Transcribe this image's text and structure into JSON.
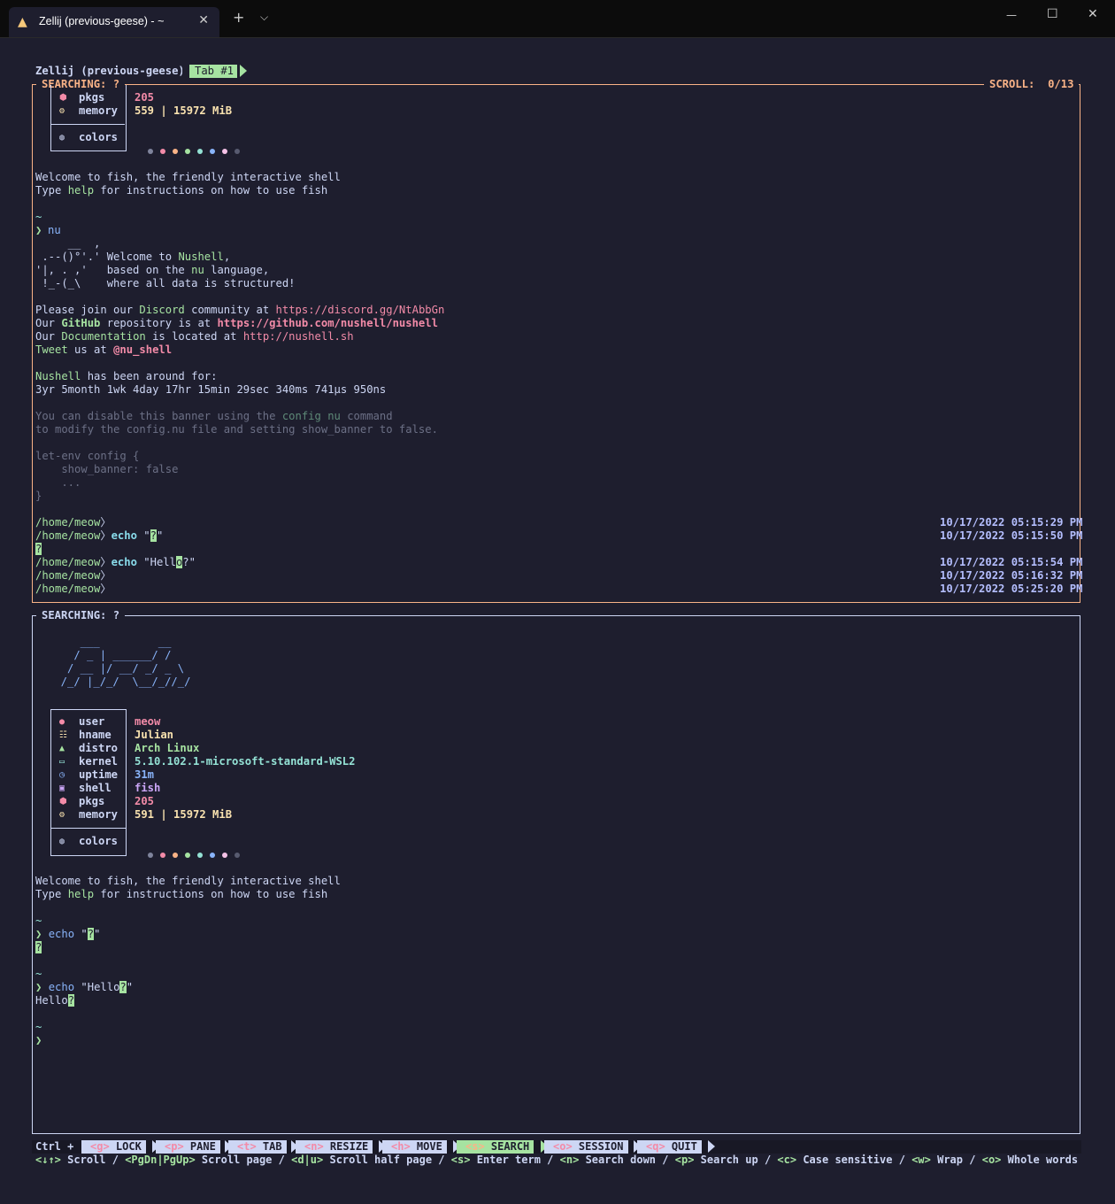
{
  "window": {
    "tab_title": "Zellij (previous-geese) - ~",
    "new_tab": "+",
    "dropdown": "⌵",
    "minimize": "—",
    "maximize": "☐",
    "close": "✕",
    "tab_close": "✕"
  },
  "zellij": {
    "session_label": "Zellij (previous-geese)",
    "tab_label": "Tab #1"
  },
  "pane1": {
    "title": "SEARCHING: ?",
    "scroll_label": "SCROLL:",
    "scroll_value": "0/13",
    "sysinfo": [
      {
        "label": "pkgs",
        "value": "205"
      },
      {
        "label": "memory",
        "value": "559 | 15972 MiB"
      }
    ],
    "colors_label": "colors",
    "fish_welcome_1": "Welcome to fish, the friendly interactive shell",
    "fish_welcome_2_a": "Type ",
    "fish_welcome_2_b": "help",
    "fish_welcome_2_c": " for instructions on how to use fish",
    "tilde": "~",
    "prompt_char": "❯",
    "nu_cmd": "nu",
    "nu_art_1": "     __  ,",
    "nu_art_2": " .--()°'.' Welcome to ",
    "nu_art_2_b": "Nushell",
    "nu_art_2_c": ",",
    "nu_art_3": "'|, . ,'   based on the ",
    "nu_art_3_b": "nu",
    "nu_art_3_c": " language,",
    "nu_art_4": " !_-(_\\    where all data is structured!",
    "discord_a": "Please join our ",
    "discord_b": "Discord",
    "discord_c": " community at ",
    "discord_d": "https://discord.gg/NtAbbGn",
    "github_a": "Our ",
    "github_b": "GitHub",
    "github_c": " repository is at ",
    "github_d": "https://github.com/nushell/nushell",
    "docs_a": "Our ",
    "docs_b": "Documentation",
    "docs_c": " is located at ",
    "docs_d": "http://nushell.sh",
    "tweet_a": "Tweet",
    "tweet_b": " us at ",
    "tweet_c": "@nu_shell",
    "around_a": "Nushell",
    "around_b": " has been around for:",
    "uptime": "3yr 5month 1wk 4day 17hr 15min 29sec 340ms 741µs 950ns",
    "disable_1_a": "You can disable this banner using the ",
    "disable_1_b": "config nu",
    "disable_1_c": " command",
    "disable_2": "to modify the config.nu file and setting show_banner to false.",
    "letenv_1": "let-env config {",
    "letenv_2": "    show_banner: false",
    "letenv_3": "    ...",
    "letenv_4": "}",
    "path": "/home/meow",
    "echo_cmd": "echo",
    "echo_arg1_a": "\"",
    "echo_arg1_b": "?",
    "echo_arg1_c": "\"",
    "out_q": "?",
    "echo_arg2_a": "\"Hell",
    "echo_arg2_b": "o",
    "echo_arg2_c": "?\"",
    "timestamps": [
      "10/17/2022 05:15:29 PM",
      "10/17/2022 05:15:50 PM",
      "10/17/2022 05:15:54 PM",
      "10/17/2022 05:16:32 PM",
      "10/17/2022 05:25:20 PM"
    ]
  },
  "pane2": {
    "title": "SEARCHING: ?",
    "arch_art": [
      "    ___              __",
      "   /   |  _________/ /_",
      "  / /| | / ___/ ___/ __ \\",
      " / ___ |/ /  / /__/ / / /",
      "/_/  |_/_/   \\___/_/ /_/"
    ],
    "arch_art_real": [
      "     ___         __",
      "    / _ | ______/ /",
      "   / __ |/ __/ _/ _ \\",
      "  /_/ |_/_/  \\__/_//_/"
    ],
    "sysinfo": [
      {
        "label": "user",
        "value": "meow",
        "icon": "user-icon"
      },
      {
        "label": "hname",
        "value": "Julian",
        "icon": "hostname-icon"
      },
      {
        "label": "distro",
        "value": "Arch Linux",
        "icon": "distro-icon"
      },
      {
        "label": "kernel",
        "value": "5.10.102.1-microsoft-standard-WSL2",
        "icon": "kernel-icon"
      },
      {
        "label": "uptime",
        "value": "31m",
        "icon": "clock-icon"
      },
      {
        "label": "shell",
        "value": "fish",
        "icon": "shell-icon"
      },
      {
        "label": "pkgs",
        "value": "205",
        "icon": "package-icon"
      },
      {
        "label": "memory",
        "value": "591 | 15972 MiB",
        "icon": "memory-icon"
      }
    ],
    "colors_label": "colors",
    "fish_welcome_1": "Welcome to fish, the friendly interactive shell",
    "fish_welcome_2_a": "Type ",
    "fish_welcome_2_b": "help",
    "fish_welcome_2_c": " for instructions on how to use fish",
    "tilde": "~",
    "prompt_char": "❯",
    "echo_cmd": "echo",
    "echo1_a": "\"",
    "echo1_b": "?",
    "echo1_c": "\"",
    "out1": "?",
    "echo2_a": "\"Hello",
    "echo2_b": "?",
    "echo2_c": "\"",
    "out2_a": "Hello",
    "out2_b": "?"
  },
  "statusbar": {
    "ctrl_label": "Ctrl +",
    "modes": [
      {
        "key": "<g>",
        "label": "LOCK"
      },
      {
        "key": "<p>",
        "label": "PANE"
      },
      {
        "key": "<t>",
        "label": "TAB"
      },
      {
        "key": "<n>",
        "label": "RESIZE"
      },
      {
        "key": "<h>",
        "label": "MOVE"
      },
      {
        "key": "<s>",
        "label": "SEARCH"
      },
      {
        "key": "<o>",
        "label": "SESSION"
      },
      {
        "key": "<q>",
        "label": "QUIT"
      }
    ],
    "hints": [
      {
        "key": "<↓↑>",
        "label": "Scroll"
      },
      {
        "key": "<PgDn|PgUp>",
        "label": "Scroll page"
      },
      {
        "key": "<d|u>",
        "label": "Scroll half page"
      },
      {
        "key": "<s>",
        "label": "Enter term"
      },
      {
        "key": "<n>",
        "label": "Search down"
      },
      {
        "key": "<p>",
        "label": "Search up"
      },
      {
        "key": "<c>",
        "label": "Case sensitive"
      },
      {
        "key": "<w>",
        "label": "Wrap"
      },
      {
        "key": "<o>",
        "label": "Whole words"
      }
    ],
    "separator": "/"
  },
  "colors": {
    "accent": "#a6e3a1",
    "active_pane": "#fab387",
    "dots": [
      "#7f849c",
      "#f38ba8",
      "#fab387",
      "#a6e3a1",
      "#94e2d5",
      "#89b4fa",
      "#f5c2e7",
      "#585b70"
    ]
  }
}
